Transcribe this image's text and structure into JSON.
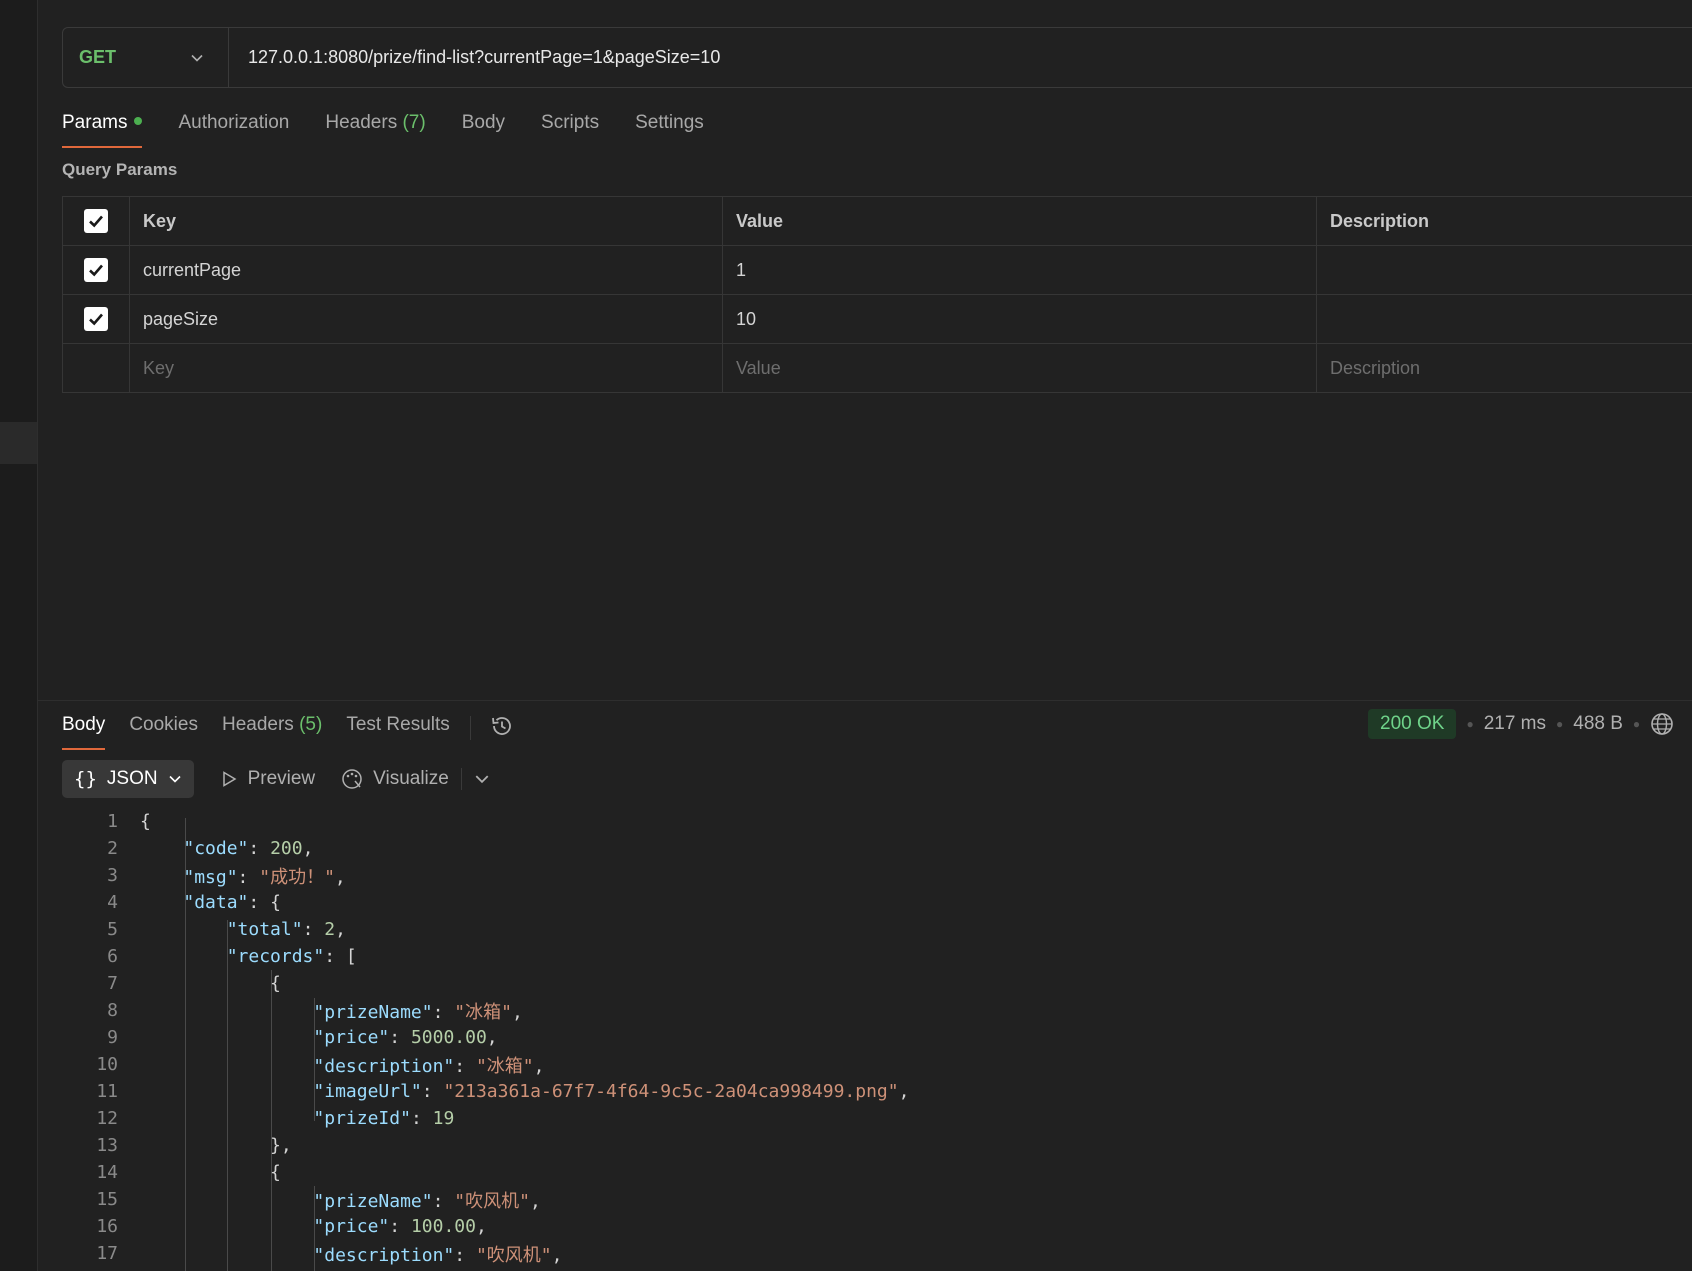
{
  "request": {
    "method": "GET",
    "url": "127.0.0.1:8080/prize/find-list?currentPage=1&pageSize=10"
  },
  "request_tabs": [
    {
      "label": "Params",
      "active": true
    },
    {
      "label": "Authorization"
    },
    {
      "label": "Headers",
      "count": "(7)"
    },
    {
      "label": "Body"
    },
    {
      "label": "Scripts"
    },
    {
      "label": "Settings"
    }
  ],
  "query_params": {
    "title": "Query Params",
    "columns": [
      "Key",
      "Value",
      "Description"
    ],
    "rows": [
      {
        "key": "currentPage",
        "value": "1",
        "description": ""
      },
      {
        "key": "pageSize",
        "value": "10",
        "description": ""
      }
    ],
    "placeholders": {
      "key": "Key",
      "value": "Value",
      "description": "Description"
    }
  },
  "response_tabs": [
    {
      "label": "Body",
      "active": true
    },
    {
      "label": "Cookies"
    },
    {
      "label": "Headers",
      "count": "(5)"
    },
    {
      "label": "Test Results"
    }
  ],
  "response_status": {
    "status": "200 OK",
    "time": "217 ms",
    "size": "488 B"
  },
  "response_toolbar": {
    "format": "JSON",
    "preview": "Preview",
    "visualize": "Visualize"
  },
  "code_lines": [
    {
      "n": "1",
      "html": "{"
    },
    {
      "n": "2",
      "html": "    <span class='k'>\"code\"</span>: <span class='n'>200</span>,"
    },
    {
      "n": "3",
      "html": "    <span class='k'>\"msg\"</span>: <span class='s'>\"成功！\"</span>,"
    },
    {
      "n": "4",
      "html": "    <span class='k'>\"data\"</span>: {"
    },
    {
      "n": "5",
      "html": "        <span class='k'>\"total\"</span>: <span class='n'>2</span>,"
    },
    {
      "n": "6",
      "html": "        <span class='k'>\"records\"</span>: ["
    },
    {
      "n": "7",
      "html": "            {"
    },
    {
      "n": "8",
      "html": "                <span class='k'>\"prizeName\"</span>: <span class='s'>\"冰箱\"</span>,"
    },
    {
      "n": "9",
      "html": "                <span class='k'>\"price\"</span>: <span class='n'>5000.00</span>,"
    },
    {
      "n": "10",
      "html": "                <span class='k'>\"description\"</span>: <span class='s'>\"冰箱\"</span>,"
    },
    {
      "n": "11",
      "html": "                <span class='k'>\"imageUrl\"</span>: <span class='s'>\"213a361a-67f7-4f64-9c5c-2a04ca998499.png\"</span>,"
    },
    {
      "n": "12",
      "html": "                <span class='k'>\"prizeId\"</span>: <span class='n'>19</span>"
    },
    {
      "n": "13",
      "html": "            },"
    },
    {
      "n": "14",
      "html": "            {"
    },
    {
      "n": "15",
      "html": "                <span class='k'>\"prizeName\"</span>: <span class='s'>\"吹风机\"</span>,"
    },
    {
      "n": "16",
      "html": "                <span class='k'>\"price\"</span>: <span class='n'>100.00</span>,"
    },
    {
      "n": "17",
      "html": "                <span class='k'>\"description\"</span>: <span class='s'>\"吹风机\"</span>,"
    }
  ]
}
